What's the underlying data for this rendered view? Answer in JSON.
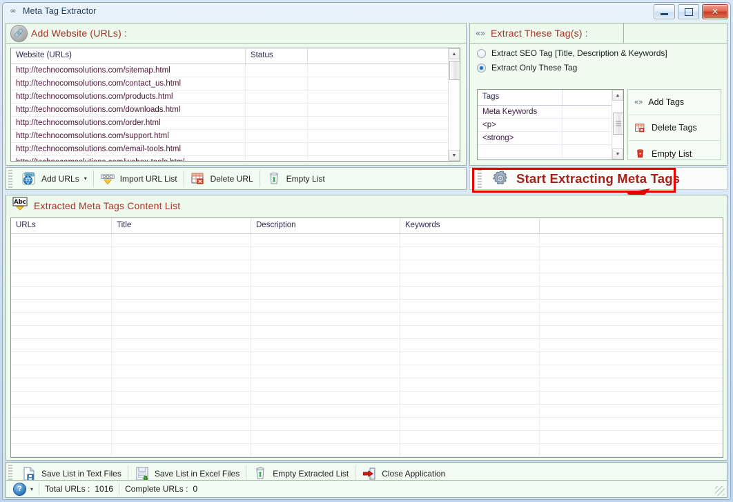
{
  "window": {
    "title": "Meta Tag Extractor",
    "app_icon": "link-chain-icon",
    "minimize_label": "Minimize",
    "maximize_label": "Maximize",
    "close_label": "Close",
    "close_glyph": "✕"
  },
  "add_website_panel": {
    "icon": "link-icon",
    "title": "Add Website (URLs) :",
    "grid": {
      "columns": [
        "Website (URLs)",
        "Status",
        ""
      ],
      "rows": [
        [
          "http://technocomsolutions.com/sitemap.html",
          "",
          ""
        ],
        [
          "http://technocomsolutions.com/contact_us.html",
          "",
          ""
        ],
        [
          "http://technocomsolutions.com/products.html",
          "",
          ""
        ],
        [
          "http://technocomsolutions.com/downloads.html",
          "",
          ""
        ],
        [
          "http://technocomsolutions.com/order.html",
          "",
          ""
        ],
        [
          "http://technocomsolutions.com/support.html",
          "",
          ""
        ],
        [
          "http://technocomsolutions.com/email-tools.html",
          "",
          ""
        ],
        [
          "http://technocomsolutions.com/webex-tools.html",
          "",
          ""
        ]
      ]
    }
  },
  "url_toolbar": {
    "buttons": [
      {
        "label": "Add URLs",
        "icon": "globe-www-icon",
        "has_dropdown": true,
        "dropdown_glyph": "▾"
      },
      {
        "label": "Import URL List",
        "icon": "import-chain-icon",
        "has_dropdown": false,
        "dropdown_glyph": ""
      },
      {
        "label": "Delete URL",
        "icon": "delete-grid-icon",
        "has_dropdown": false,
        "dropdown_glyph": ""
      },
      {
        "label": "Empty List",
        "icon": "recycle-bin-icon",
        "has_dropdown": false,
        "dropdown_glyph": ""
      }
    ]
  },
  "extract_panel": {
    "icon": "angle-brackets-icon",
    "title": "Extract These Tag(s) :",
    "options": [
      {
        "label": "Extract SEO Tag [Title, Description & Keywords]",
        "selected": false
      },
      {
        "label": "Extract Only These Tag",
        "selected": true
      }
    ],
    "tags_grid": {
      "columns": [
        "Tags",
        ""
      ],
      "rows": [
        "Meta Keywords",
        "<p>",
        "<strong>"
      ]
    },
    "side_buttons": [
      {
        "label": "Add Tags",
        "icon": "angle-brackets-icon"
      },
      {
        "label": "Delete Tags",
        "icon": "delete-grid-icon"
      },
      {
        "label": "Empty List",
        "icon": "trash-red-icon"
      }
    ]
  },
  "start_button": {
    "label": "Start Extracting Meta Tags",
    "icon": "gear-icon",
    "highlighted": true,
    "annotation": "red-arrow-pointing-to-start-button"
  },
  "extracted_panel": {
    "icon": "abc-icon",
    "title": "Extracted Meta Tags Content List",
    "grid": {
      "columns": [
        "URLs",
        "Title",
        "Description",
        "Keywords",
        ""
      ],
      "rows": []
    }
  },
  "bottom_toolbar": {
    "buttons": [
      {
        "label": "Save List in Text Files",
        "icon": "text-file-save-icon"
      },
      {
        "label": "Save List in Excel Files",
        "icon": "excel-file-save-icon"
      },
      {
        "label": "Empty Extracted List",
        "icon": "recycle-bin-icon"
      },
      {
        "label": "Close Application",
        "icon": "exit-door-icon"
      }
    ]
  },
  "status_bar": {
    "help_icon": "help-question-icon",
    "help_glyph": "?",
    "dropdown_glyph": "▾",
    "total_urls_label": "Total URLs :",
    "total_urls_value": "1016",
    "complete_urls_label": "Complete URLs :",
    "complete_urls_value": "0"
  },
  "colors": {
    "panel_bg": "#f0fbf0",
    "panel_border": "#9cb39c",
    "title_red": "#a63226",
    "start_red": "#a7201a",
    "annotation_red": "#e60000",
    "url_text": "#4a1233",
    "titlebar_text": "#1b3a57"
  }
}
